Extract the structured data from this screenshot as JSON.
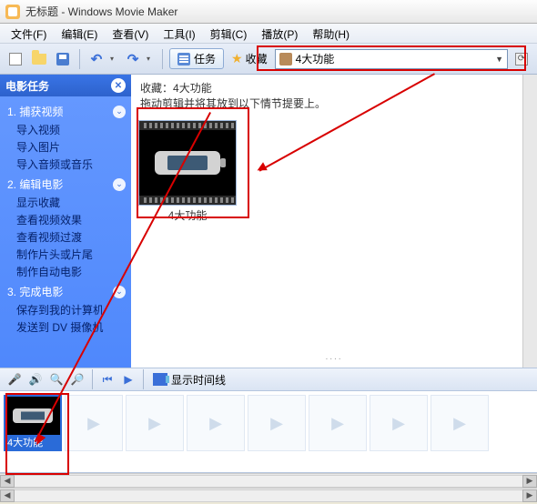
{
  "titlebar": {
    "title": "无标题 - Windows Movie Maker"
  },
  "menu": {
    "file": "文件(F)",
    "edit": "编辑(E)",
    "view": "查看(V)",
    "tools": "工具(I)",
    "clip": "剪辑(C)",
    "play": "播放(P)",
    "help": "帮助(H)"
  },
  "toolbar": {
    "tasks_label": "任务",
    "fav_label": "收藏",
    "select_value": "4大功能"
  },
  "collection": {
    "heading_prefix": "收藏：",
    "heading_name": "4大功能",
    "hint": "拖动剪辑并将其放到以下情节提要上。",
    "thumb_label": "4大功能"
  },
  "sidebar": {
    "title": "电影任务",
    "sections": [
      {
        "num": "1.",
        "title": "捕获视频",
        "links": [
          "导入视频",
          "导入图片",
          "导入音频或音乐"
        ]
      },
      {
        "num": "2.",
        "title": "编辑电影",
        "links": [
          "显示收藏",
          "查看视频效果",
          "查看视频过渡",
          "制作片头或片尾",
          "制作自动电影"
        ]
      },
      {
        "num": "3.",
        "title": "完成电影",
        "links": [
          "保存到我的计算机",
          "发送到 DV 摄像机"
        ]
      }
    ]
  },
  "ctrlbar": {
    "timeline_btn": "显示时间线"
  },
  "timeline": {
    "clip0_label": "4大功能"
  }
}
